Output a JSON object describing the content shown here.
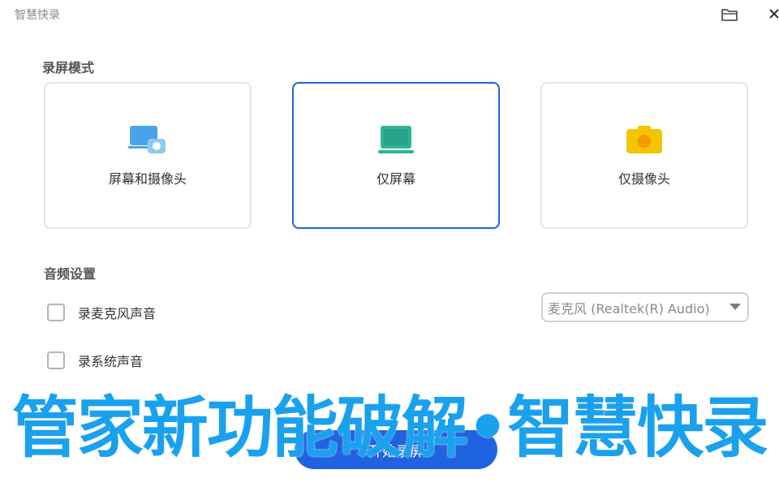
{
  "window": {
    "title": "智慧快录",
    "folder_icon": "folder-icon",
    "close_icon": "close-icon"
  },
  "record_mode": {
    "title": "录屏模式",
    "options": [
      {
        "label": "屏幕和摄像头",
        "icon": "screen-camera-icon",
        "selected": false
      },
      {
        "label": "仅屏幕",
        "icon": "laptop-screen-icon",
        "selected": true
      },
      {
        "label": "仅摄像头",
        "icon": "camera-icon",
        "selected": false
      }
    ]
  },
  "audio": {
    "title": "音频设置",
    "mic_checkbox_label": "录麦克风声音",
    "mic_checked": false,
    "system_checkbox_label": "录系统声音",
    "system_checked": false,
    "mic_device": "麦克风 (Realtek(R) Audio)"
  },
  "start_button": "开始录屏",
  "overlay_banner": "管家新功能破解•智慧快录",
  "colors": {
    "accent": "#1f63e0",
    "selected_border": "#1f63d6",
    "banner": "#1aa1ee",
    "laptop_icon": "#2bb596",
    "camera_icon": "#f4c400",
    "screen_camera_icon": "#4aa3e6"
  }
}
